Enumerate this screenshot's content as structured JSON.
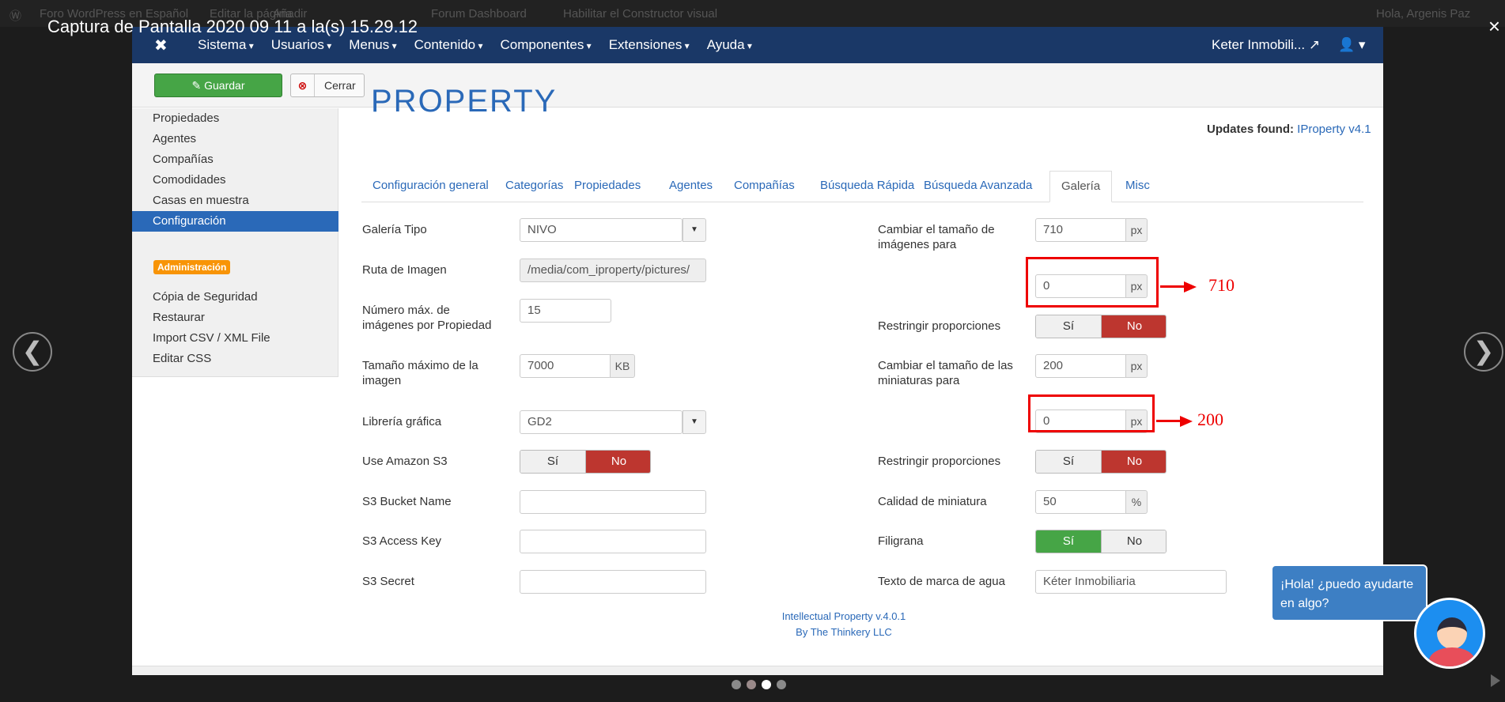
{
  "overlay": {
    "wp_bar": [
      "Foro WordPress en Español",
      "Editar la página",
      "Añadir",
      "Forum Dashboard",
      "Habilitar el Constructor visual",
      "Hola, Argenis Paz"
    ],
    "lightbox_title": "Captura de Pantalla 2020 09 11 a la(s) 15.29.12",
    "close": "×",
    "prev": "❮",
    "next": "❯"
  },
  "topnav": {
    "logo": "✖",
    "menu": [
      "Sistema",
      "Usuarios",
      "Menus",
      "Contenido",
      "Componentes",
      "Extensiones",
      "Ayuda"
    ],
    "site_name": "Keter Inmobili... ↗",
    "user_icon": "user-icon",
    "user_label": "👤 ▾"
  },
  "toolbar": {
    "save_label": "Guardar",
    "save_icon": "✎",
    "close_label": "Cerrar",
    "close_icon": "⊗"
  },
  "sidebar": {
    "items": [
      "Propiedades",
      "Agentes",
      "Compañías",
      "Comodidades",
      "Casas en muestra",
      "Configuración"
    ],
    "admin_badge": "Administración",
    "admin_items": [
      "Cópia de Seguridad",
      "Restaurar",
      "Import CSV / XML File",
      "Editar CSS"
    ]
  },
  "brand": "PROPERTY",
  "updates": {
    "label": "Updates found:",
    "link": "IProperty v4.1"
  },
  "tabs": [
    "Configuración general",
    "Categorías",
    "Propiedades",
    "Agentes",
    "Compañías",
    "Búsqueda Rápida",
    "Búsqueda Avanzada",
    "Galería",
    "Misc"
  ],
  "left_form": {
    "galeria_tipo": {
      "label": "Galería Tipo",
      "value": "NIVO"
    },
    "ruta_imagen": {
      "label": "Ruta de Imagen",
      "value": "/media/com_iproperty/pictures/"
    },
    "num_max": {
      "label": "Número máx. de imágenes por Propiedad",
      "value": "15"
    },
    "tam_max": {
      "label": "Tamaño máximo de la imagen",
      "value": "7000",
      "unit": "KB"
    },
    "libreria": {
      "label": "Librería gráfica",
      "value": "GD2"
    },
    "amazon": {
      "label": "Use Amazon S3",
      "yes": "Sí",
      "no": "No"
    },
    "bucket": {
      "label": "S3 Bucket Name",
      "value": ""
    },
    "access": {
      "label": "S3 Access Key",
      "value": ""
    },
    "secret": {
      "label": "S3 Secret",
      "value": ""
    }
  },
  "right_form": {
    "resize_images": {
      "label": "Cambiar el tamaño de imágenes para",
      "width": "710",
      "height": "0",
      "unit": "px"
    },
    "restrict1": {
      "label": "Restringir proporciones",
      "yes": "Sí",
      "no": "No"
    },
    "resize_thumbs": {
      "label": "Cambiar el tamaño de las miniaturas para",
      "width": "200",
      "height": "0",
      "unit": "px"
    },
    "restrict2": {
      "label": "Restringir proporciones",
      "yes": "Sí",
      "no": "No"
    },
    "quality": {
      "label": "Calidad de miniatura",
      "value": "50",
      "unit": "%"
    },
    "watermark": {
      "label": "Filigrana",
      "yes": "Sí",
      "no": "No"
    },
    "watermark_text": {
      "label": "Texto de marca de agua",
      "value": "Kéter Inmobiliaria"
    }
  },
  "annotations": {
    "a1": "710",
    "a2": "200"
  },
  "credit": {
    "line1": "Intellectual Property v.4.0.1",
    "line2": "By The Thinkery LLC"
  },
  "chat": {
    "message": "¡Hola! ¿puedo ayudarte en algo?"
  },
  "colors": {
    "nav": "#1a3867",
    "link": "#2a69b8",
    "save": "#46a546",
    "no_active": "#bd362f",
    "annotation": "#e00000"
  }
}
